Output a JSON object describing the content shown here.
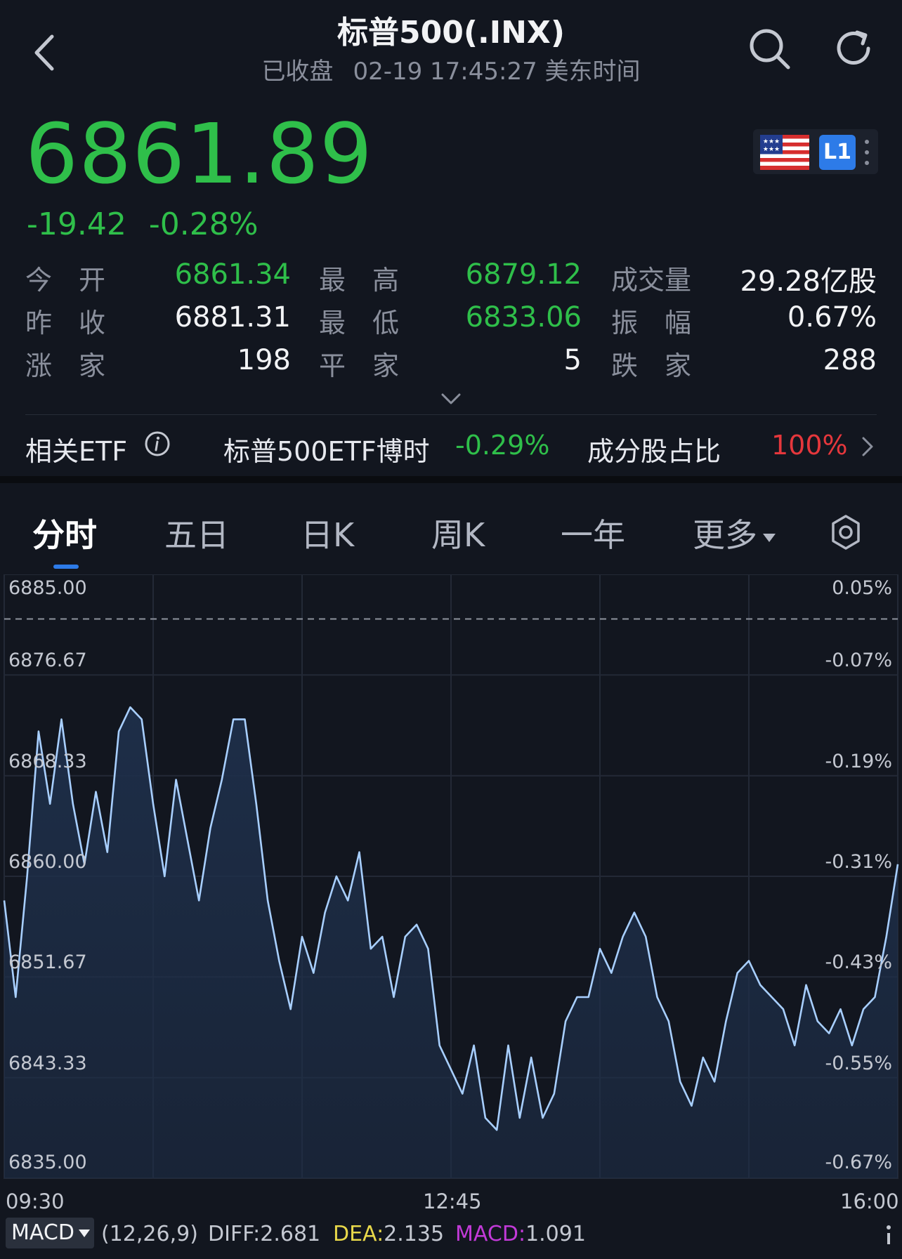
{
  "header": {
    "title": "标普500(.INX)",
    "status": "已收盘",
    "datetime": "02-19 17:45:27 美东时间"
  },
  "quote": {
    "price": "6861.89",
    "change": "-19.42",
    "change_pct": "-0.28%",
    "badge": "L1"
  },
  "stats": {
    "open_label": "今开",
    "open": "6861.34",
    "high_label": "最高",
    "high": "6879.12",
    "volume_label": "成交量",
    "volume": "29.28亿股",
    "prev_close_label": "昨收",
    "prev_close": "6881.31",
    "low_label": "最低",
    "low": "6833.06",
    "amplitude_label": "振幅",
    "amplitude": "0.67%",
    "up_label": "涨家",
    "up": "198",
    "flat_label": "平家",
    "flat": "5",
    "down_label": "跌家",
    "down": "288"
  },
  "etf": {
    "label": "相关ETF",
    "name": "标普500ETF博时",
    "change": "-0.29%",
    "component_label": "成分股占比",
    "component_value": "100%"
  },
  "tabs": [
    "分时",
    "五日",
    "日K",
    "周K",
    "一年",
    "更多"
  ],
  "chart_data": {
    "type": "line",
    "y_left_ticks": [
      "6885.00",
      "6876.67",
      "6868.33",
      "6860.00",
      "6851.67",
      "6843.33",
      "6835.00"
    ],
    "y_right_ticks": [
      "0.05%",
      "-0.07%",
      "-0.19%",
      "-0.31%",
      "-0.43%",
      "-0.55%",
      "-0.67%"
    ],
    "ylim": [
      6835.0,
      6885.0
    ],
    "prev_close": 6881.31,
    "x_ticks": [
      "09:30",
      "12:45",
      "16:00"
    ],
    "xlim": [
      "09:30",
      "16:00"
    ],
    "x": [
      "09:30",
      "09:35",
      "09:40",
      "09:45",
      "09:50",
      "09:55",
      "10:00",
      "10:05",
      "10:10",
      "10:15",
      "10:20",
      "10:25",
      "10:30",
      "10:35",
      "10:40",
      "10:45",
      "10:50",
      "10:55",
      "11:00",
      "11:05",
      "11:10",
      "11:15",
      "11:20",
      "11:25",
      "11:30",
      "11:35",
      "11:40",
      "11:45",
      "11:50",
      "11:55",
      "12:00",
      "12:05",
      "12:10",
      "12:15",
      "12:20",
      "12:25",
      "12:30",
      "12:35",
      "12:40",
      "12:45",
      "12:50",
      "12:55",
      "13:00",
      "13:05",
      "13:10",
      "13:15",
      "13:20",
      "13:25",
      "13:30",
      "13:35",
      "13:40",
      "13:45",
      "13:50",
      "13:55",
      "14:00",
      "14:05",
      "14:10",
      "14:15",
      "14:20",
      "14:25",
      "14:30",
      "14:35",
      "14:40",
      "14:45",
      "14:50",
      "14:55",
      "15:00",
      "15:05",
      "15:10",
      "15:15",
      "15:20",
      "15:25",
      "15:30",
      "15:35",
      "15:40",
      "15:45",
      "15:50",
      "15:55",
      "16:00"
    ],
    "values": [
      6858,
      6850,
      6860,
      6872,
      6866,
      6873,
      6866,
      6861,
      6867,
      6862,
      6872,
      6874,
      6873,
      6866,
      6860,
      6868,
      6863,
      6858,
      6864,
      6868,
      6873,
      6873,
      6866,
      6858,
      6853,
      6849,
      6855,
      6852,
      6857,
      6860,
      6858,
      6862,
      6854,
      6855,
      6850,
      6855,
      6856,
      6854,
      6846,
      6844,
      6842,
      6846,
      6840,
      6839,
      6846,
      6840,
      6845,
      6840,
      6842,
      6848,
      6850,
      6850,
      6854,
      6852,
      6855,
      6857,
      6855,
      6850,
      6848,
      6843,
      6841,
      6845,
      6843,
      6848,
      6852,
      6853,
      6851,
      6850,
      6849,
      6846,
      6851,
      6848,
      6847,
      6849,
      6846,
      6849,
      6850,
      6855,
      6861
    ],
    "indicator": {
      "name": "MACD",
      "params": "(12,26,9)",
      "diff_label": "DIFF",
      "diff": "2.681",
      "dea_label": "DEA",
      "dea": "2.135",
      "macd_label": "MACD",
      "macd": "1.091"
    },
    "colors": {
      "line": "#a8cfff",
      "fill_top": "#1e2f4a",
      "grid": "#232936",
      "prev_close_line": "#8f949e"
    }
  },
  "colors": {
    "down": "#2fbf4a",
    "up": "#e5373c",
    "accent": "#2d7be8",
    "bg": "#12161f"
  }
}
